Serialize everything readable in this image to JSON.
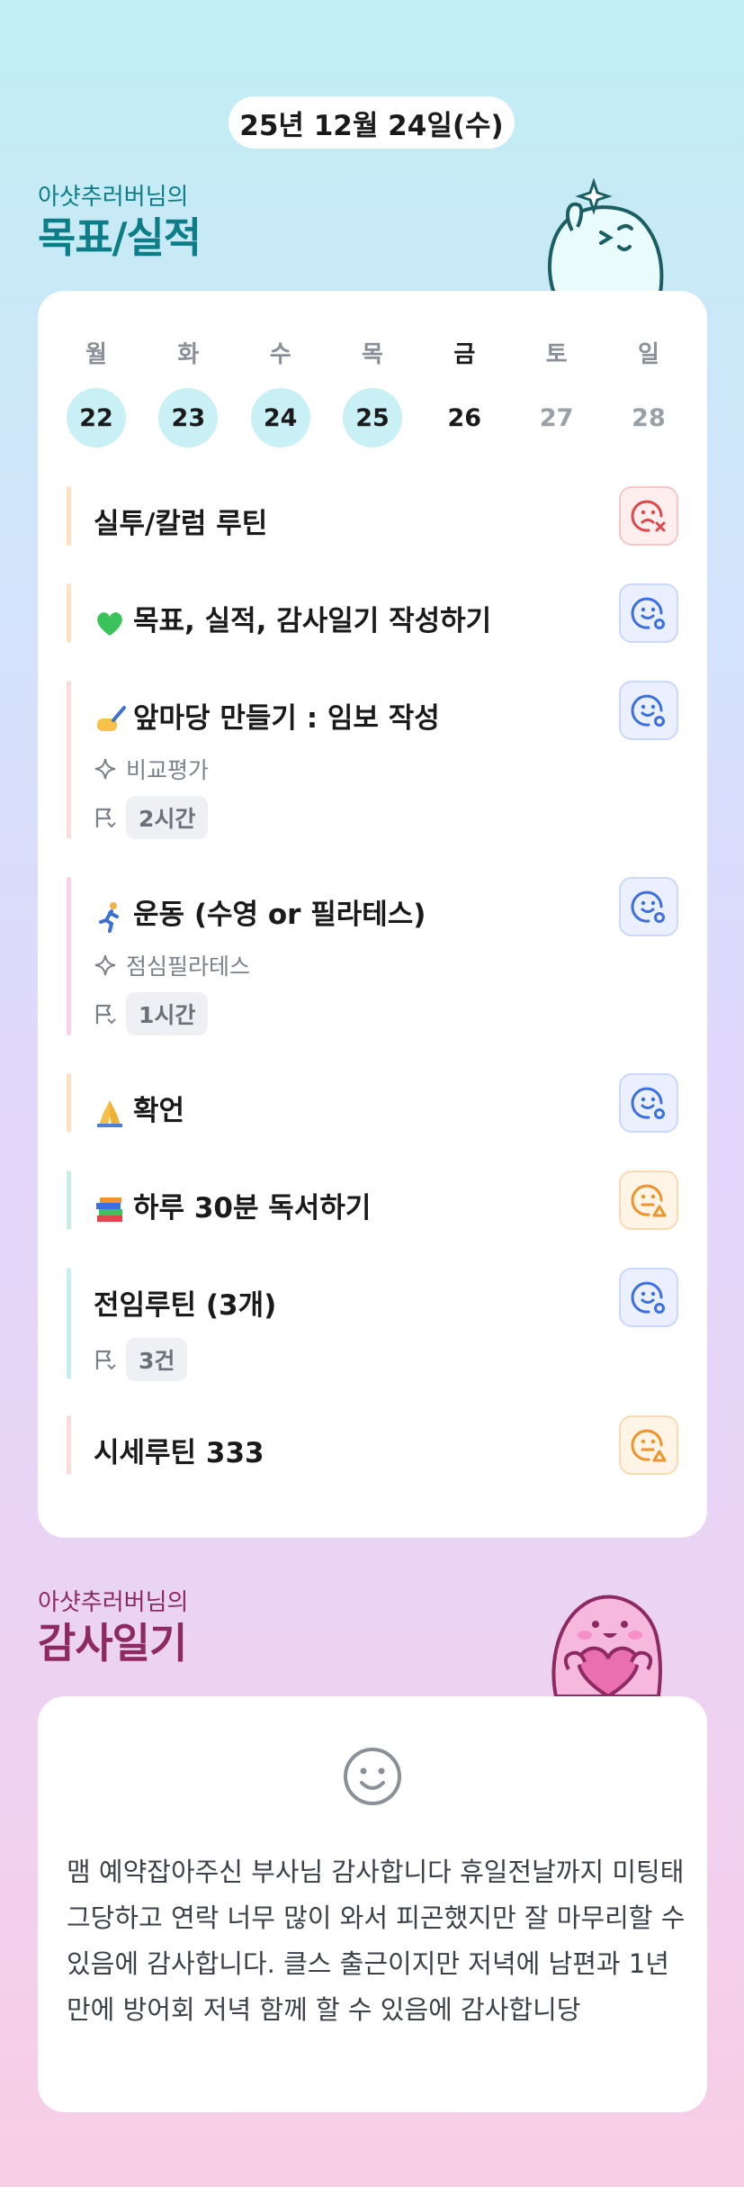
{
  "header": {
    "date": "25년 12월 24일(수)"
  },
  "goals": {
    "owner": "아샷추러버님의",
    "title": "목표/실적",
    "weekdays": [
      "월",
      "화",
      "수",
      "목",
      "금",
      "토",
      "일"
    ],
    "dates": [
      "22",
      "23",
      "24",
      "25",
      "26",
      "27",
      "28"
    ],
    "tasks": [
      {
        "title": "실투/칼럼 루틴",
        "status": "red"
      },
      {
        "title": "목표, 실적, 감사일기 작성하기",
        "icon": "green-heart-icon",
        "status": "blue"
      },
      {
        "title": "앞마당 만들기 : 임보 작성",
        "icon": "writing-hand-icon",
        "sub": "비교평가",
        "chip": "2시간",
        "status": "blue"
      },
      {
        "title": "운동 (수영 or 필라테스)",
        "icon": "runner-icon",
        "sub": "점심필라테스",
        "chip": "1시간",
        "status": "blue"
      },
      {
        "title": "확언",
        "icon": "praying-hands-icon",
        "status": "blue"
      },
      {
        "title": "하루 30분 독서하기",
        "icon": "books-icon",
        "status": "orange"
      },
      {
        "title": "전임루틴 (3개)",
        "chip": "3건",
        "status": "blue"
      },
      {
        "title": "시세루틴 333",
        "status": "orange"
      }
    ]
  },
  "diary": {
    "owner": "아샷추러버님의",
    "title": "감사일기",
    "text": "맴 예약잡아주신 부사님 감사합니다 휴일전날까지 미팅태그당하고 연락 너무 많이 와서 피곤했지만 잘 마무리할 수 있음에 감사합니다. 클스 출근이지만 저녁에 남편과 1년만에 방어회 저녁 함께 할 수 있음에 감사합니당"
  },
  "colors": {
    "goal_title": "#0d7e87",
    "diary_title": "#8e2a63",
    "status_blue": "#3d6fe0",
    "status_red": "#e0474c",
    "status_orange": "#f0932b"
  }
}
